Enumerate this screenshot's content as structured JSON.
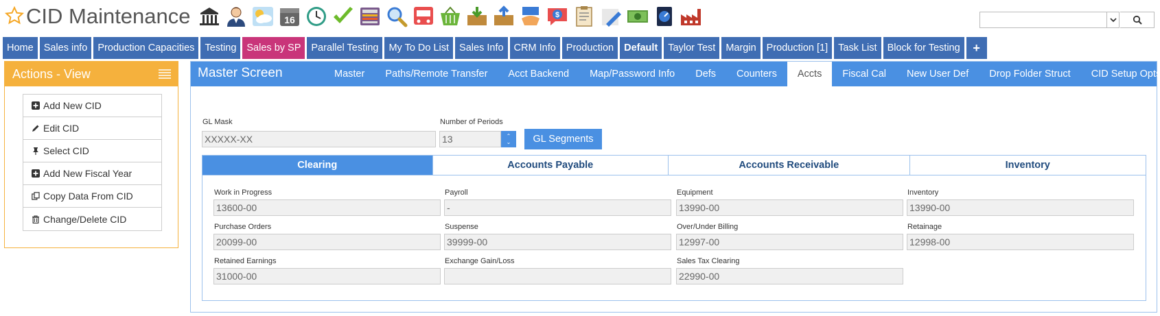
{
  "app": {
    "title": "CID Maintenance"
  },
  "toolbar_icons": [
    "bank-icon",
    "user-icon",
    "weather-icon",
    "calendar-16-icon",
    "clock-icon",
    "checkmark-icon",
    "calculator-icon",
    "magnifier-icon",
    "bus-icon",
    "basket-icon",
    "download-box-icon",
    "upload-box-icon",
    "handshake-icon",
    "dollar-chat-icon",
    "clipboard-icon",
    "pencil-icon",
    "money-icon",
    "gauge-icon",
    "factory-icon"
  ],
  "calendar_day": "16",
  "nav": {
    "tabs": [
      {
        "label": "Home",
        "style": ""
      },
      {
        "label": "Sales info",
        "style": ""
      },
      {
        "label": "Production Capacities",
        "style": ""
      },
      {
        "label": "Testing",
        "style": ""
      },
      {
        "label": "Sales by SP",
        "style": "pink"
      },
      {
        "label": "Parallel Testing",
        "style": ""
      },
      {
        "label": "My To Do List",
        "style": ""
      },
      {
        "label": "Sales Info",
        "style": ""
      },
      {
        "label": "CRM Info",
        "style": ""
      },
      {
        "label": "Production",
        "style": ""
      },
      {
        "label": "Default",
        "style": "bold"
      },
      {
        "label": "Taylor Test",
        "style": ""
      },
      {
        "label": "Margin",
        "style": ""
      },
      {
        "label": "Production [1]",
        "style": ""
      },
      {
        "label": "Task List",
        "style": ""
      },
      {
        "label": "Block for Testing",
        "style": ""
      }
    ],
    "plus_label": "+"
  },
  "actions": {
    "title": "Actions - View",
    "items": [
      {
        "label": "Add New CID",
        "icon": "plus-square-icon"
      },
      {
        "label": "Edit CID",
        "icon": "pencil-icon"
      },
      {
        "label": "Select CID",
        "icon": "pin-icon"
      },
      {
        "label": "Add New Fiscal Year",
        "icon": "plus-square-icon"
      },
      {
        "label": "Copy Data From CID",
        "icon": "copy-icon"
      },
      {
        "label": "Change/Delete CID",
        "icon": "trash-icon"
      }
    ]
  },
  "master": {
    "title": "Master Screen",
    "tabs": [
      "Master",
      "Paths/Remote Transfer",
      "Acct Backend",
      "Map/Password Info",
      "Defs",
      "Counters",
      "Accts",
      "Fiscal Cal",
      "New User Def",
      "Drop Folder Struct",
      "CID Setup Opts"
    ],
    "active_tab": "Accts",
    "gl_mask_label": "GL Mask",
    "gl_mask_value": "XXXXX-XX",
    "periods_label": "Number of Periods",
    "periods_value": "13",
    "gl_segments_label": "GL Segments"
  },
  "accounts": {
    "tabs": [
      "Clearing",
      "Accounts Payable",
      "Accounts Receivable",
      "Inventory"
    ],
    "active_tab": "Clearing",
    "fields": [
      {
        "label": "Work in Progress",
        "value": "13600-00"
      },
      {
        "label": "Payroll",
        "value": "-"
      },
      {
        "label": "Equipment",
        "value": "13990-00"
      },
      {
        "label": "Inventory",
        "value": "13990-00"
      },
      {
        "label": "Purchase Orders",
        "value": "20099-00"
      },
      {
        "label": "Suspense",
        "value": "39999-00"
      },
      {
        "label": "Over/Under Billing",
        "value": "12997-00"
      },
      {
        "label": "Retainage",
        "value": "12998-00"
      },
      {
        "label": "Retained Earnings",
        "value": "31000-00"
      },
      {
        "label": "Exchange Gain/Loss",
        "value": ""
      },
      {
        "label": "Sales Tax Clearing",
        "value": "22990-00"
      }
    ]
  },
  "colors": {
    "nav_blue": "#3f6db3",
    "nav_pink": "#c9357a",
    "panel_orange": "#f5b13d",
    "accent_blue": "#4a90e2",
    "tab_text": "#1f4a7d"
  }
}
